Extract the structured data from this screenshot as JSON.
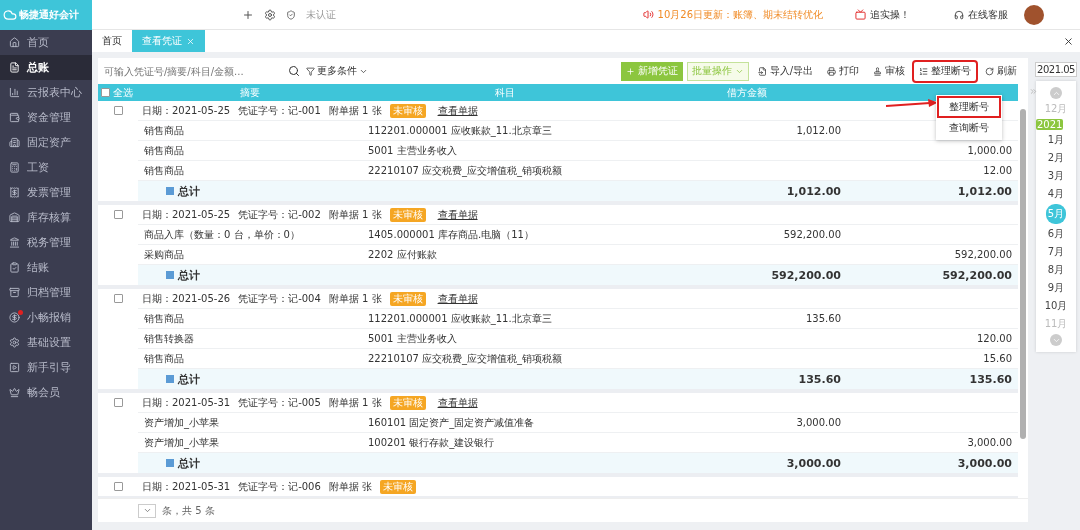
{
  "app": {
    "name": "畅捷通好会计",
    "auth": "未认证",
    "notice": "10月26日更新：账簿、期末结转优化",
    "promo": "追实操！",
    "support": "在线客服"
  },
  "sidebar": {
    "items": [
      {
        "label": "首页",
        "selected": false,
        "dot": false
      },
      {
        "label": "总账",
        "selected": true,
        "dot": false
      },
      {
        "label": "云报表中心",
        "selected": false,
        "dot": false
      },
      {
        "label": "资金管理",
        "selected": false,
        "dot": false
      },
      {
        "label": "固定资产",
        "selected": false,
        "dot": false
      },
      {
        "label": "工资",
        "selected": false,
        "dot": false
      },
      {
        "label": "发票管理",
        "selected": false,
        "dot": false
      },
      {
        "label": "库存核算",
        "selected": false,
        "dot": false
      },
      {
        "label": "税务管理",
        "selected": false,
        "dot": false
      },
      {
        "label": "结账",
        "selected": false,
        "dot": false
      },
      {
        "label": "归档管理",
        "selected": false,
        "dot": false
      },
      {
        "label": "小畅报销",
        "selected": false,
        "dot": true
      },
      {
        "label": "基础设置",
        "selected": false,
        "dot": false
      },
      {
        "label": "新手引导",
        "selected": false,
        "dot": false
      },
      {
        "label": "畅会员",
        "selected": false,
        "dot": false
      }
    ]
  },
  "tabs": [
    {
      "label": "首页",
      "selected": false,
      "closable": false
    },
    {
      "label": "查看凭证",
      "selected": true,
      "closable": true
    }
  ],
  "toolbar": {
    "search_placeholder": "可输入凭证号/摘要/科目/金额...",
    "filter": "更多条件",
    "buttons": [
      {
        "label": "新增凭证",
        "kind": "primary",
        "highlighted": false
      },
      {
        "label": "批量操作",
        "kind": "dropdown",
        "highlighted": false
      },
      {
        "label": "导入/导出",
        "kind": "plain",
        "highlighted": false
      },
      {
        "label": "打印",
        "kind": "plain",
        "highlighted": false
      },
      {
        "label": "审核",
        "kind": "plain",
        "highlighted": false
      },
      {
        "label": "整理断号",
        "kind": "plain",
        "highlighted": true
      },
      {
        "label": "刷新",
        "kind": "plain",
        "highlighted": false
      }
    ]
  },
  "menu": {
    "items": [
      {
        "label": "整理断号",
        "selected": true
      },
      {
        "label": "查询断号",
        "selected": false
      }
    ]
  },
  "table": {
    "select_all": {
      "label": "全选",
      "checked": false
    },
    "columns": [
      "摘要",
      "科目",
      "借方金额"
    ],
    "vouchers": [
      {
        "date": "日期：2021-05-25",
        "number": "凭证字号：记-001",
        "attachments": "附单据 1 张",
        "status": "未审核",
        "link": "查看单据",
        "checked": false,
        "rows": [
          {
            "summary": "销售商品",
            "account": "112201.000001 应收账款_11.北京章三",
            "debit": "1,012.00",
            "credit": ""
          },
          {
            "summary": "销售商品",
            "account": "5001 主营业务收入",
            "debit": "",
            "credit": "1,000.00"
          },
          {
            "summary": "销售商品",
            "account": "22210107 应交税费_应交增值税_销项税额",
            "debit": "",
            "credit": "12.00"
          }
        ],
        "total": {
          "label": "总计",
          "debit": "1,012.00",
          "credit": "1,012.00"
        }
      },
      {
        "date": "日期：2021-05-25",
        "number": "凭证字号：记-002",
        "attachments": "附单据 1 张",
        "status": "未审核",
        "link": "查看单据",
        "checked": false,
        "rows": [
          {
            "summary": "商品入库（数量：0 台，单价：0）",
            "account": "1405.000001 库存商品.电脑（11）",
            "debit": "592,200.00",
            "credit": ""
          },
          {
            "summary": "采购商品",
            "account": "2202 应付账款",
            "debit": "",
            "credit": "592,200.00"
          }
        ],
        "total": {
          "label": "总计",
          "debit": "592,200.00",
          "credit": "592,200.00"
        }
      },
      {
        "date": "日期：2021-05-26",
        "number": "凭证字号：记-004",
        "attachments": "附单据 1 张",
        "status": "未审核",
        "link": "查看单据",
        "checked": false,
        "rows": [
          {
            "summary": "销售商品",
            "account": "112201.000001 应收账款_11.北京章三",
            "debit": "135.60",
            "credit": ""
          },
          {
            "summary": "销售转换器",
            "account": "5001 主营业务收入",
            "debit": "",
            "credit": "120.00"
          },
          {
            "summary": "销售商品",
            "account": "22210107 应交税费_应交增值税_销项税额",
            "debit": "",
            "credit": "15.60"
          }
        ],
        "total": {
          "label": "总计",
          "debit": "135.60",
          "credit": "135.60"
        }
      },
      {
        "date": "日期：2021-05-31",
        "number": "凭证字号：记-005",
        "attachments": "附单据 1 张",
        "status": "未审核",
        "link": "查看单据",
        "checked": false,
        "rows": [
          {
            "summary": "资产增加_小苹果",
            "account": "160101 固定资产_固定资产减值准备",
            "debit": "3,000.00",
            "credit": ""
          },
          {
            "summary": "资产增加_小苹果",
            "account": "100201 银行存款_建设银行",
            "debit": "",
            "credit": "3,000.00"
          }
        ],
        "total": {
          "label": "总计",
          "debit": "3,000.00",
          "credit": "3,000.00"
        }
      },
      {
        "date": "日期：2021-05-31",
        "number": "凭证字号：记-006",
        "attachments": "附单据 张",
        "status": "未审核",
        "checked": false
      }
    ]
  },
  "pagination": {
    "summary": "条，共 5 条"
  },
  "calendar": {
    "current": "2021.05",
    "year_tag": "2021",
    "months": [
      {
        "label": "12月",
        "selected": false,
        "disabled": true,
        "year_start": false
      },
      {
        "label": "1月",
        "selected": false,
        "disabled": false,
        "year_start": true
      },
      {
        "label": "2月",
        "selected": false,
        "disabled": false,
        "year_start": false
      },
      {
        "label": "3月",
        "selected": false,
        "disabled": false,
        "year_start": false
      },
      {
        "label": "4月",
        "selected": false,
        "disabled": false,
        "year_start": false
      },
      {
        "label": "5月",
        "selected": true,
        "disabled": false,
        "year_start": false
      },
      {
        "label": "6月",
        "selected": false,
        "disabled": false,
        "year_start": false
      },
      {
        "label": "7月",
        "selected": false,
        "disabled": false,
        "year_start": false
      },
      {
        "label": "8月",
        "selected": false,
        "disabled": false,
        "year_start": false
      },
      {
        "label": "9月",
        "selected": false,
        "disabled": false,
        "year_start": false
      },
      {
        "label": "10月",
        "selected": false,
        "disabled": false,
        "year_start": false
      },
      {
        "label": "11月",
        "selected": false,
        "disabled": true,
        "year_start": false
      }
    ]
  }
}
